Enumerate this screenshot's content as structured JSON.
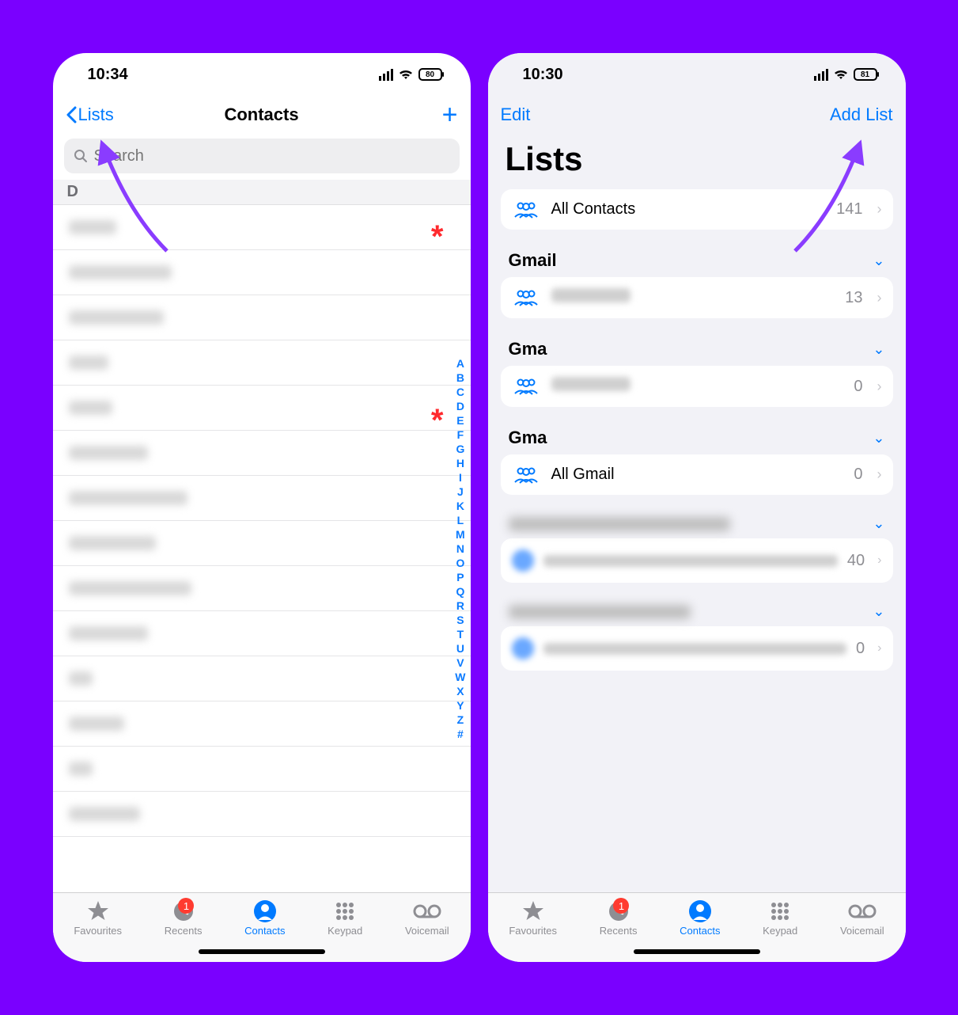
{
  "left": {
    "status": {
      "time": "10:34",
      "battery": "80"
    },
    "nav": {
      "back": "Lists",
      "title": "Contacts"
    },
    "search": {
      "placeholder": "Search"
    },
    "section_letter": "D",
    "index": [
      "A",
      "B",
      "C",
      "D",
      "E",
      "F",
      "G",
      "H",
      "I",
      "J",
      "K",
      "L",
      "M",
      "N",
      "O",
      "P",
      "Q",
      "R",
      "S",
      "T",
      "U",
      "V",
      "W",
      "X",
      "Y",
      "Z",
      "#"
    ]
  },
  "right": {
    "status": {
      "time": "10:30",
      "battery": "81"
    },
    "nav": {
      "edit": "Edit",
      "add": "Add List"
    },
    "title": "Lists",
    "allContacts": {
      "label": "All Contacts",
      "count": "141"
    },
    "groups": [
      {
        "title": "Gmail",
        "row": {
          "label": "",
          "count": "13",
          "blurred": true
        }
      },
      {
        "title": "Gma",
        "row": {
          "label": "",
          "count": "0",
          "blurred": true
        }
      },
      {
        "title": "Gma",
        "row": {
          "label": "All Gmail",
          "count": "0",
          "blurred": false
        }
      }
    ],
    "faded": [
      {
        "count": "40"
      },
      {
        "count": "0"
      }
    ]
  },
  "tabs": {
    "favourites": "Favourites",
    "recents": "Recents",
    "contacts": "Contacts",
    "keypad": "Keypad",
    "voicemail": "Voicemail",
    "badge": "1"
  }
}
